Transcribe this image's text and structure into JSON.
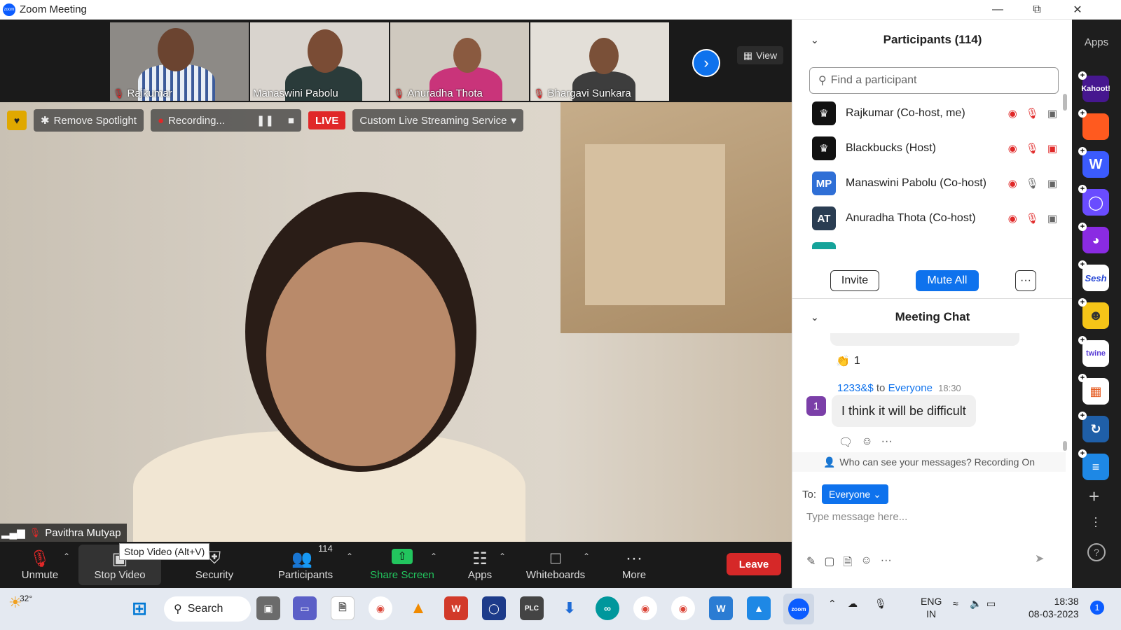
{
  "window": {
    "title": "Zoom Meeting"
  },
  "gallery": {
    "tiles": [
      {
        "name": "Rajkumar"
      },
      {
        "name": "Manaswini Pabolu"
      },
      {
        "name": "Anuradha Thota"
      },
      {
        "name": "Bhargavi Sunkara"
      }
    ],
    "view_label": "View"
  },
  "main_video": {
    "remove_spotlight_label": "Remove Spotlight",
    "recording_label": "Recording...",
    "live_label": "LIVE",
    "streaming_label": "Custom Live Streaming Service",
    "speaker_name": "Pavithra Mutyap"
  },
  "toolbar": {
    "unmute_label": "Unmute",
    "stop_video_label": "Stop Video",
    "stop_video_tooltip": "Stop Video (Alt+V)",
    "security_label": "Security",
    "participants_label": "Participants",
    "participants_count": "114",
    "share_screen_label": "Share Screen",
    "apps_label": "Apps",
    "whiteboards_label": "Whiteboards",
    "more_label": "More",
    "leave_label": "Leave"
  },
  "participants_panel": {
    "title": "Participants (114)",
    "search_placeholder": "Find a participant",
    "list": [
      {
        "name": "Rajkumar (Co-host, me)",
        "initials": "",
        "avatar_color": "#111111",
        "mic": "muted",
        "video": "on"
      },
      {
        "name": "Blackbucks (Host)",
        "initials": "",
        "avatar_color": "#111111",
        "mic": "muted",
        "video": "off"
      },
      {
        "name": "Manaswini Pabolu (Co-host)",
        "initials": "MP",
        "avatar_color": "#2f6fd6",
        "mic": "on",
        "video": "on"
      },
      {
        "name": "Anuradha Thota (Co-host)",
        "initials": "AT",
        "avatar_color": "#2a3d52",
        "mic": "muted",
        "video": "on"
      }
    ],
    "invite_label": "Invite",
    "mute_all_label": "Mute All",
    "more_label": "···"
  },
  "chat_panel": {
    "title": "Meeting Chat",
    "reaction_count": "1",
    "message": {
      "sender": "1233&$",
      "to_text": "to",
      "recipient": "Everyone",
      "time": "18:30",
      "avatar_initial": "1",
      "text": "I think it will be difficult"
    },
    "visibility_note": "Who can see your messages? Recording On",
    "to_label": "To:",
    "to_value": "Everyone",
    "input_placeholder": "Type message here..."
  },
  "apps_rail": {
    "label": "Apps",
    "apps": [
      {
        "name": "Kahoot!",
        "color": "#46178f"
      },
      {
        "name": "",
        "color": "#ff5a1f"
      },
      {
        "name": "W",
        "color": "#3b5bfd"
      },
      {
        "name": "",
        "color": "#6a4cff"
      },
      {
        "name": "",
        "color": "#8a2be2"
      },
      {
        "name": "Sesh",
        "color": "#ffffff"
      },
      {
        "name": "",
        "color": "#f5c518"
      },
      {
        "name": "twine",
        "color": "#ffffff"
      },
      {
        "name": "",
        "color": "#ffffff"
      },
      {
        "name": "",
        "color": "#1f5fa8"
      },
      {
        "name": "",
        "color": "#1e88e5"
      }
    ]
  },
  "taskbar": {
    "weather_temp": "32°",
    "search_label": "Search",
    "lang_1": "ENG",
    "lang_2": "IN",
    "time": "18:38",
    "date": "08-03-2023",
    "notification_count": "1"
  },
  "colors": {
    "accent": "#0e72ed",
    "leave": "#d62828",
    "live": "#e02828",
    "share_screen": "#22c55e"
  }
}
